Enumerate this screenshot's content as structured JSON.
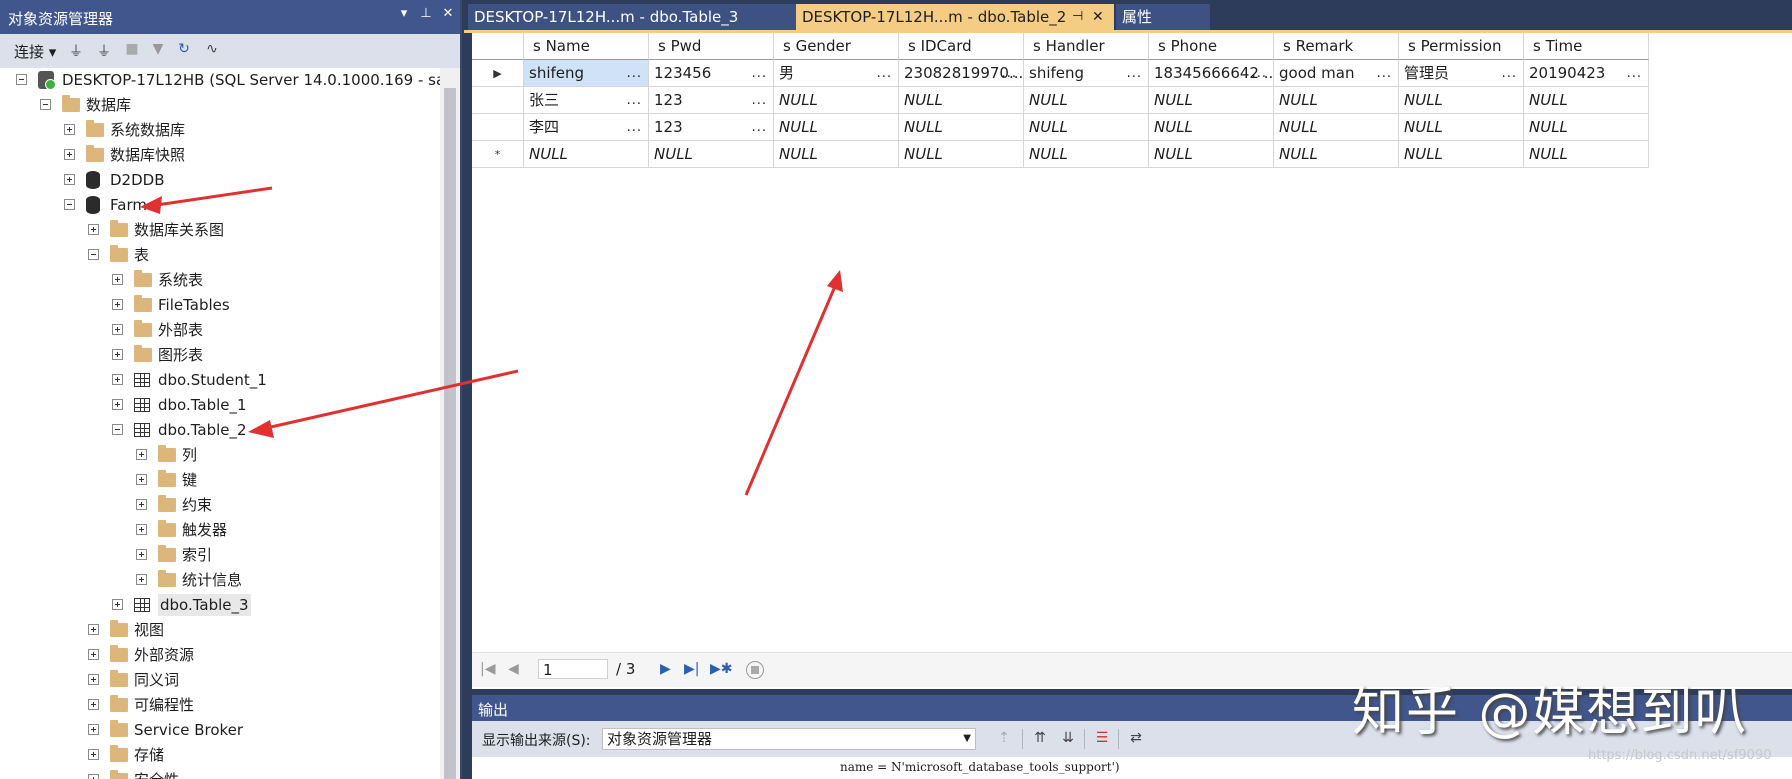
{
  "object_explorer": {
    "title": "对象资源管理器",
    "pin_symbol": "▾ ⊥ ✕",
    "toolbar": {
      "connect": "连接 ▾"
    },
    "tree": [
      {
        "label": "DESKTOP-17L12HB (SQL Server 14.0.1000.169 - sa)",
        "icon": "server",
        "level": 0,
        "expander": "minus"
      },
      {
        "label": "数据库",
        "icon": "folder",
        "level": 1,
        "expander": "minus"
      },
      {
        "label": "系统数据库",
        "icon": "folder",
        "level": 2,
        "expander": "plus"
      },
      {
        "label": "数据库快照",
        "icon": "folder",
        "level": 2,
        "expander": "plus"
      },
      {
        "label": "D2DDB",
        "icon": "database",
        "level": 2,
        "expander": "plus"
      },
      {
        "label": "Farm",
        "icon": "database",
        "level": 2,
        "expander": "minus"
      },
      {
        "label": "数据库关系图",
        "icon": "folder",
        "level": 3,
        "expander": "plus"
      },
      {
        "label": "表",
        "icon": "folder",
        "level": 3,
        "expander": "minus"
      },
      {
        "label": "系统表",
        "icon": "folder",
        "level": 4,
        "expander": "plus"
      },
      {
        "label": "FileTables",
        "icon": "folder",
        "level": 4,
        "expander": "plus"
      },
      {
        "label": "外部表",
        "icon": "folder",
        "level": 4,
        "expander": "plus"
      },
      {
        "label": "图形表",
        "icon": "folder",
        "level": 4,
        "expander": "plus"
      },
      {
        "label": "dbo.Student_1",
        "icon": "table",
        "level": 4,
        "expander": "plus"
      },
      {
        "label": "dbo.Table_1",
        "icon": "table",
        "level": 4,
        "expander": "plus"
      },
      {
        "label": "dbo.Table_2",
        "icon": "table",
        "level": 4,
        "expander": "minus"
      },
      {
        "label": "列",
        "icon": "folder",
        "level": 5,
        "expander": "plus"
      },
      {
        "label": "键",
        "icon": "folder",
        "level": 5,
        "expander": "plus"
      },
      {
        "label": "约束",
        "icon": "folder",
        "level": 5,
        "expander": "plus"
      },
      {
        "label": "触发器",
        "icon": "folder",
        "level": 5,
        "expander": "plus"
      },
      {
        "label": "索引",
        "icon": "folder",
        "level": 5,
        "expander": "plus"
      },
      {
        "label": "统计信息",
        "icon": "folder",
        "level": 5,
        "expander": "plus"
      },
      {
        "label": "dbo.Table_3",
        "icon": "table",
        "level": 4,
        "expander": "plus",
        "selected": true
      },
      {
        "label": "视图",
        "icon": "folder",
        "level": 3,
        "expander": "plus"
      },
      {
        "label": "外部资源",
        "icon": "folder",
        "level": 3,
        "expander": "plus"
      },
      {
        "label": "同义词",
        "icon": "folder",
        "level": 3,
        "expander": "plus"
      },
      {
        "label": "可编程性",
        "icon": "folder",
        "level": 3,
        "expander": "plus"
      },
      {
        "label": "Service Broker",
        "icon": "folder",
        "level": 3,
        "expander": "plus"
      },
      {
        "label": "存储",
        "icon": "folder",
        "level": 3,
        "expander": "plus"
      },
      {
        "label": "安全性",
        "icon": "folder",
        "level": 3,
        "expander": "plus"
      }
    ]
  },
  "tabs": [
    {
      "label": "DESKTOP-17L12H...m - dbo.Table_3",
      "active": false
    },
    {
      "label": "DESKTOP-17L12H...m - dbo.Table_2",
      "active": true
    },
    {
      "label": "属性",
      "active": false
    }
  ],
  "grid": {
    "columns": [
      "s Name",
      "s Pwd",
      "s Gender",
      "s IDCard",
      "s Handler",
      "s Phone",
      "s Remark",
      "s Permission",
      "s Time"
    ],
    "rows": [
      {
        "marker": "▶",
        "cells": [
          "shifeng",
          "123456",
          "男",
          "23082819970...",
          "shifeng",
          "18345666642 ...",
          "good man",
          "管理员",
          "20190423"
        ]
      },
      {
        "marker": "",
        "cells": [
          "张三",
          "123",
          "NULL",
          "NULL",
          "NULL",
          "NULL",
          "NULL",
          "NULL",
          "NULL"
        ]
      },
      {
        "marker": "",
        "cells": [
          "李四",
          "123",
          "NULL",
          "NULL",
          "NULL",
          "NULL",
          "NULL",
          "NULL",
          "NULL"
        ]
      },
      {
        "marker": "*",
        "cells": [
          "NULL",
          "NULL",
          "NULL",
          "NULL",
          "NULL",
          "NULL",
          "NULL",
          "NULL",
          "NULL"
        ]
      }
    ]
  },
  "navigator": {
    "current_page": "1",
    "total": "/ 3"
  },
  "output": {
    "title": "输出",
    "source_label": "显示输出来源(S):",
    "source_value": "对象资源管理器",
    "text": "name = N'microsoft_database_tools_support')"
  },
  "watermark": {
    "main": "知乎 @媒想到叭",
    "url": "https://blog.csdn.net/sf9090"
  },
  "colors": {
    "accent": "#40568d",
    "active_tab": "#f5cc84",
    "annotation_arrow": "#e03030"
  }
}
